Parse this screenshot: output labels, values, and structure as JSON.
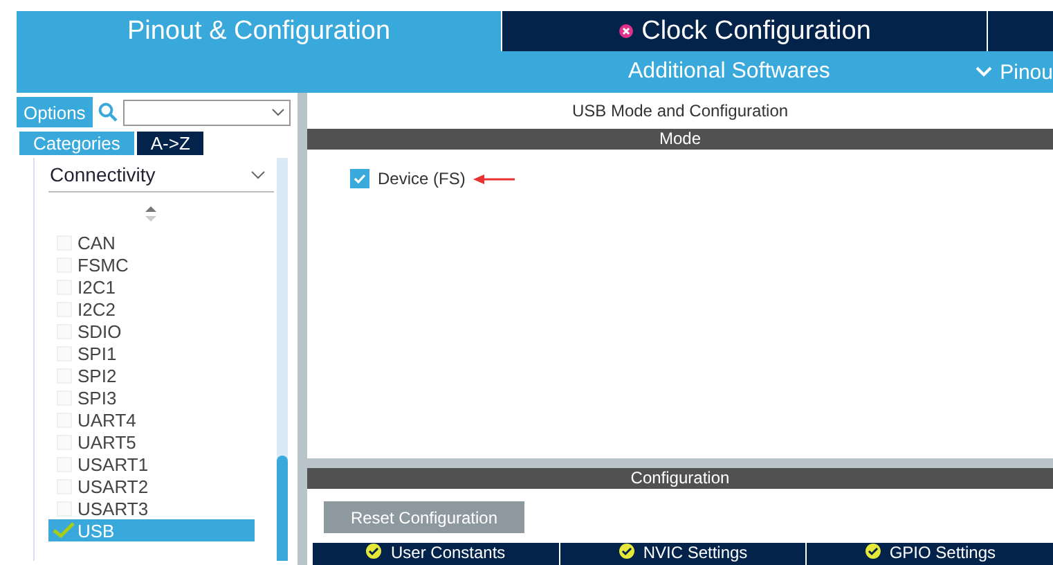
{
  "top_tabs": [
    {
      "label": "Pinout & Configuration",
      "selected": true,
      "error": false
    },
    {
      "label": "Clock Configuration",
      "selected": false,
      "error": true
    }
  ],
  "sub_tabs": [
    {
      "label": "Additional Softwares",
      "kind": "plain"
    },
    {
      "label": "Pinou",
      "kind": "menu"
    }
  ],
  "sidebar": {
    "options_button": "Options",
    "view_tabs": [
      {
        "label": "Categories",
        "selected": true
      },
      {
        "label": "A->Z",
        "selected": false
      }
    ],
    "category": {
      "label": "Connectivity",
      "expanded": true
    },
    "items": [
      {
        "label": "CAN",
        "checked": false,
        "selected": false
      },
      {
        "label": "FSMC",
        "checked": false,
        "selected": false
      },
      {
        "label": "I2C1",
        "checked": false,
        "selected": false
      },
      {
        "label": "I2C2",
        "checked": false,
        "selected": false
      },
      {
        "label": "SDIO",
        "checked": false,
        "selected": false
      },
      {
        "label": "SPI1",
        "checked": false,
        "selected": false
      },
      {
        "label": "SPI2",
        "checked": false,
        "selected": false
      },
      {
        "label": "SPI3",
        "checked": false,
        "selected": false
      },
      {
        "label": "UART4",
        "checked": false,
        "selected": false
      },
      {
        "label": "UART5",
        "checked": false,
        "selected": false
      },
      {
        "label": "USART1",
        "checked": false,
        "selected": false
      },
      {
        "label": "USART2",
        "checked": false,
        "selected": false
      },
      {
        "label": "USART3",
        "checked": false,
        "selected": false
      },
      {
        "label": "USB",
        "checked": true,
        "selected": true
      }
    ]
  },
  "main": {
    "title": "USB Mode and Configuration",
    "mode_header": "Mode",
    "mode_options": [
      {
        "label": "Device (FS)",
        "checked": true
      }
    ],
    "config_header": "Configuration",
    "reset_button": "Reset Configuration",
    "config_tabs": [
      {
        "label": "User Constants",
        "valid": true
      },
      {
        "label": "NVIC Settings",
        "valid": true
      },
      {
        "label": "GPIO Settings",
        "valid": true
      }
    ]
  }
}
